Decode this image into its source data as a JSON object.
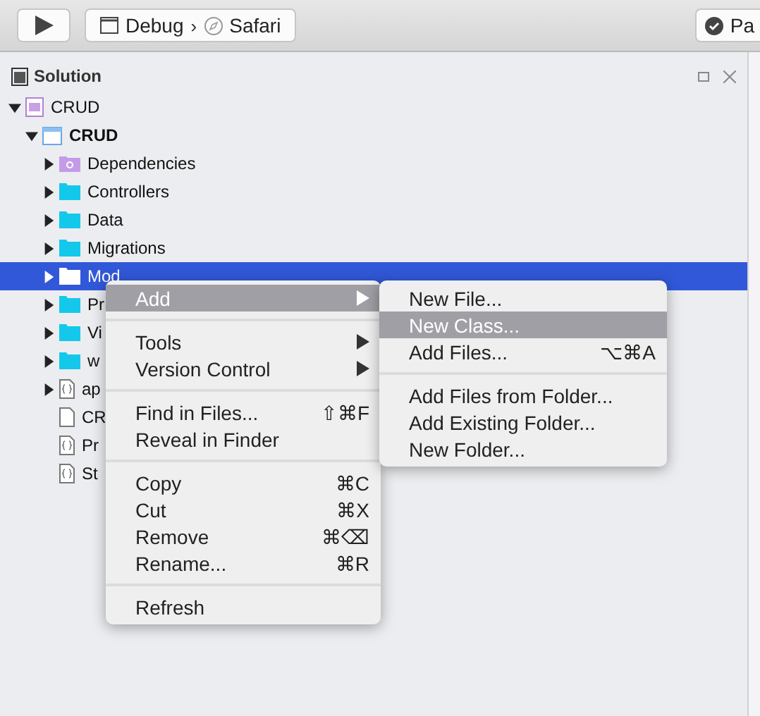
{
  "toolbar": {
    "config": "Debug",
    "separator": "›",
    "target": "Safari",
    "right_button": "Pa"
  },
  "panel": {
    "title": "Solution"
  },
  "tree": [
    {
      "label": "CRUD",
      "kind": "solution",
      "bold": false,
      "collapsible": true,
      "expanded": true,
      "selected": false,
      "children": [
        {
          "label": "CRUD",
          "kind": "project",
          "bold": true,
          "collapsible": true,
          "expanded": true,
          "selected": false,
          "children": [
            {
              "label": "Dependencies",
              "kind": "deps",
              "bold": false,
              "collapsible": true,
              "expanded": false,
              "selected": false
            },
            {
              "label": "Controllers",
              "kind": "folder",
              "bold": false,
              "collapsible": true,
              "expanded": false,
              "selected": false
            },
            {
              "label": "Data",
              "kind": "folder",
              "bold": false,
              "collapsible": true,
              "expanded": false,
              "selected": false
            },
            {
              "label": "Migrations",
              "kind": "folder",
              "bold": false,
              "collapsible": true,
              "expanded": false,
              "selected": false
            },
            {
              "label": "Mod",
              "kind": "folder",
              "bold": false,
              "collapsible": true,
              "expanded": false,
              "selected": true
            },
            {
              "label": "Pr",
              "kind": "folder",
              "bold": false,
              "collapsible": true,
              "expanded": false,
              "selected": false
            },
            {
              "label": "Vi",
              "kind": "folder",
              "bold": false,
              "collapsible": true,
              "expanded": false,
              "selected": false
            },
            {
              "label": "w",
              "kind": "folder",
              "bold": false,
              "collapsible": true,
              "expanded": false,
              "selected": false
            },
            {
              "label": "ap",
              "kind": "json",
              "bold": false,
              "collapsible": true,
              "expanded": false,
              "selected": false
            },
            {
              "label": "CR",
              "kind": "file",
              "bold": false,
              "collapsible": false,
              "selected": false
            },
            {
              "label": "Pr",
              "kind": "json",
              "bold": false,
              "collapsible": false,
              "selected": false
            },
            {
              "label": "St",
              "kind": "json",
              "bold": false,
              "collapsible": false,
              "selected": false
            }
          ]
        }
      ]
    }
  ],
  "context_menu": {
    "groups": [
      [
        {
          "label": "Add",
          "submenu": true,
          "selected": true
        }
      ],
      [
        {
          "label": "Tools",
          "submenu": true,
          "selected": false
        },
        {
          "label": "Version Control",
          "submenu": true,
          "selected": false
        }
      ],
      [
        {
          "label": "Find in Files...",
          "shortcut": "⇧⌘F",
          "submenu": false,
          "selected": false
        },
        {
          "label": "Reveal in Finder",
          "submenu": false,
          "selected": false
        }
      ],
      [
        {
          "label": "Copy",
          "shortcut": "⌘C",
          "submenu": false,
          "selected": false
        },
        {
          "label": "Cut",
          "shortcut": "⌘X",
          "submenu": false,
          "selected": false
        },
        {
          "label": "Remove",
          "shortcut": "⌘⌫",
          "submenu": false,
          "selected": false
        },
        {
          "label": "Rename...",
          "shortcut": "⌘R",
          "submenu": false,
          "selected": false
        }
      ],
      [
        {
          "label": "Refresh",
          "submenu": false,
          "selected": false
        }
      ]
    ]
  },
  "submenu": {
    "groups": [
      [
        {
          "label": "New File...",
          "selected": false
        },
        {
          "label": "New Class...",
          "selected": true
        },
        {
          "label": "Add Files...",
          "shortcut": "⌥⌘A",
          "selected": false
        }
      ],
      [
        {
          "label": "Add Files from Folder...",
          "selected": false
        },
        {
          "label": "Add Existing Folder...",
          "selected": false
        },
        {
          "label": "New Folder...",
          "selected": false
        }
      ]
    ]
  }
}
